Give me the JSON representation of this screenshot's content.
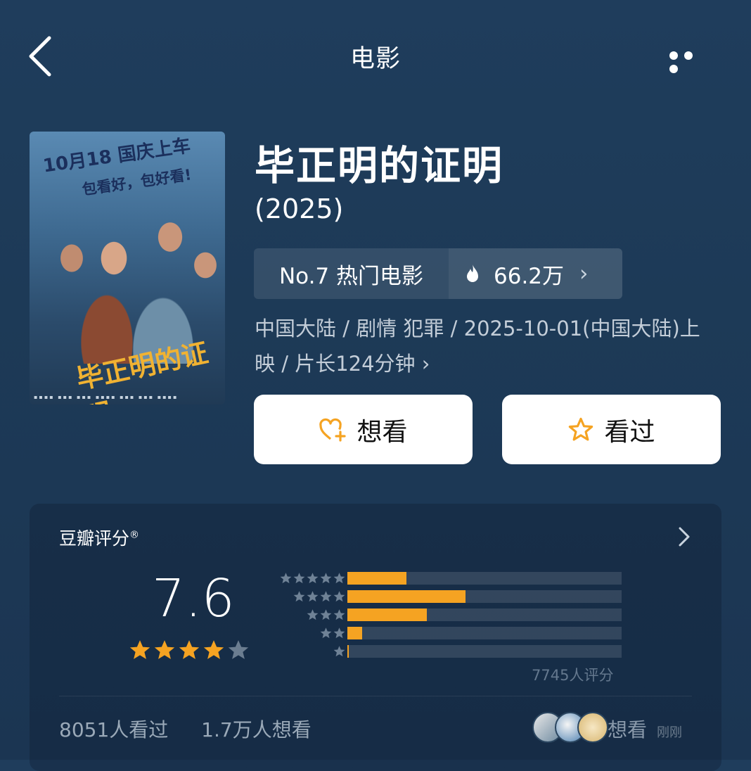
{
  "header": {
    "title": "电影"
  },
  "poster": {
    "top_text": "10月18 国庆上车",
    "sub_text": "包看好，包好看!",
    "logo_text": "毕正明的证明"
  },
  "movie": {
    "title": "毕正明的证明",
    "year": "(2025)",
    "rank": "No.7 热门电影",
    "heat": "66.2万",
    "meta_line1": "中国大陆 / 剧情 犯罪 / 2025-10-01(中国大陆)上",
    "meta_line2": "映 / 片长124分钟 ›"
  },
  "actions": {
    "want_label": "想看",
    "seen_label": "看过"
  },
  "rating": {
    "header": "豆瓣评分",
    "score": "7.6",
    "stars": 4,
    "distribution": [
      {
        "stars": 5,
        "percent": 21.5
      },
      {
        "stars": 4,
        "percent": 43
      },
      {
        "stars": 3,
        "percent": 29
      },
      {
        "stars": 2,
        "percent": 5.5
      },
      {
        "stars": 1,
        "percent": 0.5
      }
    ],
    "count_text": "7745人评分",
    "seen_text": "8051人看过",
    "want_text": "1.7万人想看",
    "friend_action": "想看",
    "friend_time": "刚刚"
  },
  "colors": {
    "accent": "#f5a322",
    "background": "#1d3a57"
  }
}
